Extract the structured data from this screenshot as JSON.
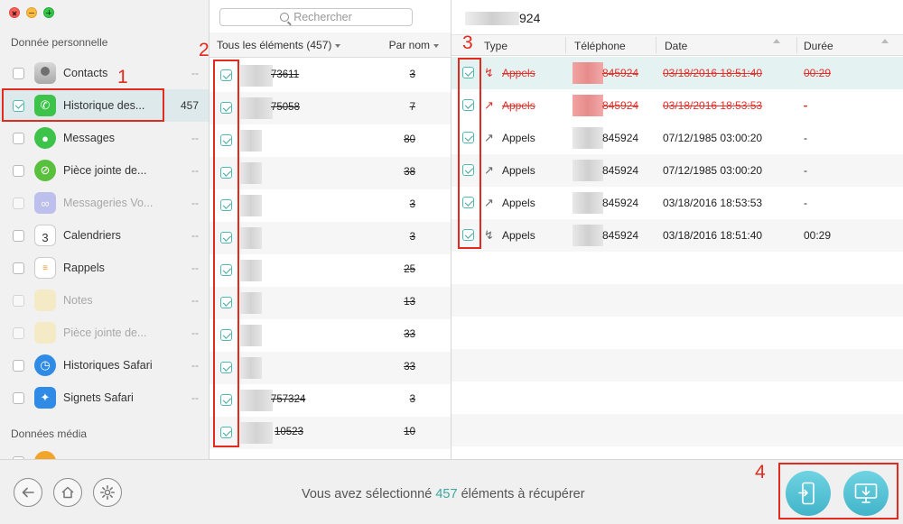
{
  "sidebar": {
    "section_personal": "Donnée personnelle",
    "section_media": "Données média",
    "items": [
      {
        "label": "Contacts",
        "count": "--",
        "checked": false,
        "enabled": true,
        "icon": "contacts-icon"
      },
      {
        "label": "Historique des...",
        "count": "457",
        "checked": true,
        "enabled": true,
        "icon": "phone-icon"
      },
      {
        "label": "Messages",
        "count": "--",
        "checked": false,
        "enabled": true,
        "icon": "messages-icon"
      },
      {
        "label": "Pièce jointe de...",
        "count": "--",
        "checked": false,
        "enabled": true,
        "icon": "paperclip-icon"
      },
      {
        "label": "Messageries Vo...",
        "count": "--",
        "checked": false,
        "enabled": false,
        "icon": "voicemail-icon"
      },
      {
        "label": "Calendriers",
        "count": "--",
        "checked": false,
        "enabled": true,
        "icon": "calendar-icon"
      },
      {
        "label": "Rappels",
        "count": "--",
        "checked": false,
        "enabled": true,
        "icon": "reminders-icon"
      },
      {
        "label": "Notes",
        "count": "--",
        "checked": false,
        "enabled": false,
        "icon": "notes-icon"
      },
      {
        "label": "Pièce jointe de...",
        "count": "--",
        "checked": false,
        "enabled": false,
        "icon": "note-attachment-icon"
      },
      {
        "label": "Historiques Safari",
        "count": "--",
        "checked": false,
        "enabled": true,
        "icon": "safari-history-icon"
      },
      {
        "label": "Signets Safari",
        "count": "--",
        "checked": false,
        "enabled": true,
        "icon": "safari-bookmarks-icon"
      }
    ],
    "calendar_icon_number": "3"
  },
  "list": {
    "search_placeholder": "Rechercher",
    "all_label": "Tous les éléments (457)",
    "sort_label": "Par nom",
    "rows": [
      {
        "number": "73611",
        "count": "3"
      },
      {
        "number": "75058",
        "count": "7"
      },
      {
        "number": "",
        "count": "80"
      },
      {
        "number": "",
        "count": "38"
      },
      {
        "number": "",
        "count": "3"
      },
      {
        "number": "",
        "count": "3"
      },
      {
        "number": "",
        "count": "25"
      },
      {
        "number": "",
        "count": "13"
      },
      {
        "number": "",
        "count": "33"
      },
      {
        "number": "",
        "count": "33"
      },
      {
        "number": "757324",
        "count": "3"
      },
      {
        "number": "10523",
        "count": "10"
      }
    ]
  },
  "detail": {
    "title_suffix": "924",
    "columns": {
      "type": "Type",
      "phone": "Téléphone",
      "date": "Date",
      "duration": "Durée"
    },
    "rows": [
      {
        "type": "Appels",
        "phone": "845924",
        "date": "03/18/2016 18:51:40",
        "duration": "00:29",
        "deleted": true
      },
      {
        "type": "Appels",
        "phone": "845924",
        "date": "03/18/2016 18:53:53",
        "duration": "-",
        "deleted": true
      },
      {
        "type": "Appels",
        "phone": "845924",
        "date": "07/12/1985 03:00:20",
        "duration": "-",
        "deleted": false
      },
      {
        "type": "Appels",
        "phone": "845924",
        "date": "07/12/1985 03:00:20",
        "duration": "-",
        "deleted": false
      },
      {
        "type": "Appels",
        "phone": "845924",
        "date": "03/18/2016 18:53:53",
        "duration": "-",
        "deleted": false
      },
      {
        "type": "Appels",
        "phone": "845924",
        "date": "03/18/2016 18:51:40",
        "duration": "00:29",
        "deleted": false
      }
    ]
  },
  "footer": {
    "status_prefix": "Vous avez sélectionné",
    "status_count": "457",
    "status_suffix": "éléments à récupérer"
  },
  "annotations": {
    "n1": "1",
    "n2": "2",
    "n3": "3",
    "n4": "4"
  },
  "colors": {
    "accent": "#3ca79f",
    "deleted": "#e0312b",
    "annotation": "#e32a1e",
    "action_button": "#42b4c9"
  }
}
